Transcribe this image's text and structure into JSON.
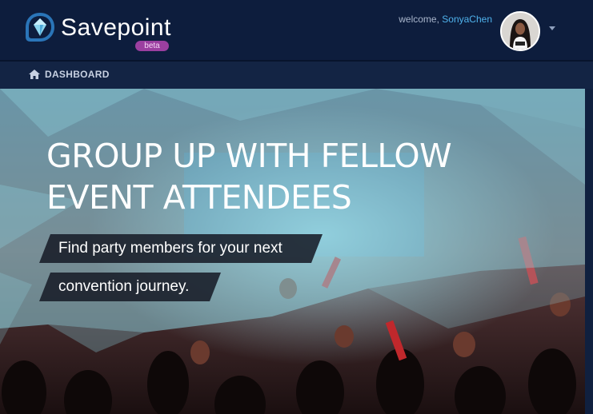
{
  "header": {
    "brand": "Savepoint",
    "badge": "beta",
    "welcome_prefix": "welcome,",
    "username": "SonyaChen"
  },
  "breadcrumb": {
    "label": "DASHBOARD"
  },
  "hero": {
    "headline_line1": "GROUP UP WITH FELLOW",
    "headline_line2": "EVENT ATTENDEES",
    "subline1": "Find party members for your next",
    "subline2": "convention journey."
  },
  "colors": {
    "nav_bg": "#0d1d3d",
    "accent_blue": "#4fb2ec",
    "beta_badge": "#9b3fa0",
    "hero_overlay": "#8fd3e0"
  },
  "icons": {
    "logo": "savepoint-crystal-icon",
    "breadcrumb": "home-icon",
    "menu": "chevron-down-icon"
  }
}
